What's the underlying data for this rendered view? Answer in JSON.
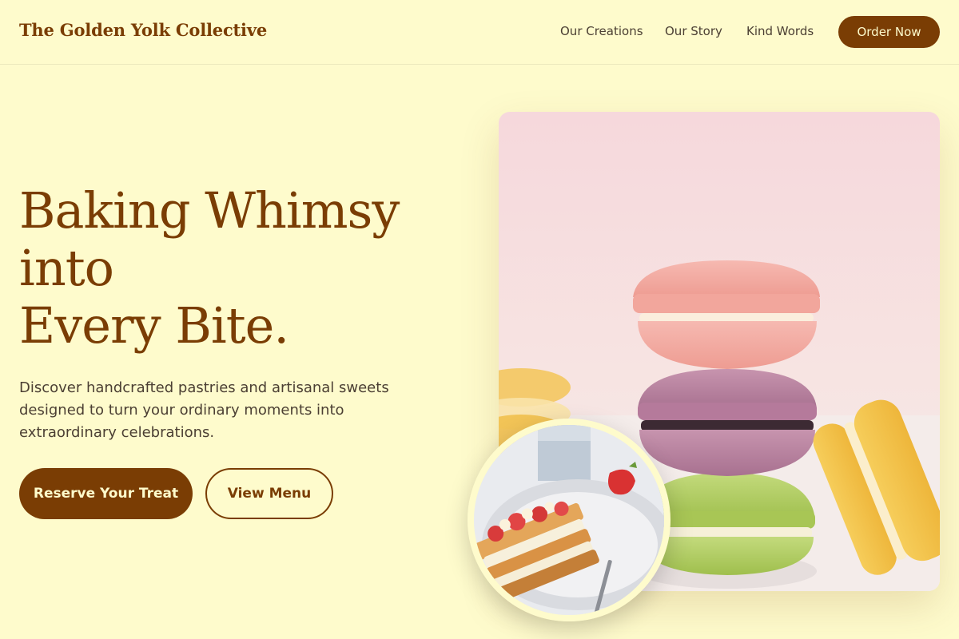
{
  "header": {
    "brand": "The Golden Yolk Collective",
    "nav": [
      "Our Creations",
      "Our Story",
      "Kind Words"
    ],
    "cta": "Order Now"
  },
  "hero": {
    "title_lines": [
      "Baking Whimsy",
      "into",
      "Every Bite."
    ],
    "description": "Discover handcrafted pastries and artisanal sweets designed to turn your ordinary moments into extraordinary celebrations.",
    "primary_button": "Reserve Your Treat",
    "secondary_button": "View Menu"
  },
  "colors": {
    "background": "#FEFBCC",
    "accent": "#7A3D04",
    "text": "#4B3F33"
  },
  "images": {
    "main": "macaron-stack-photo",
    "inset": "strawberry-mille-feuille-photo"
  }
}
